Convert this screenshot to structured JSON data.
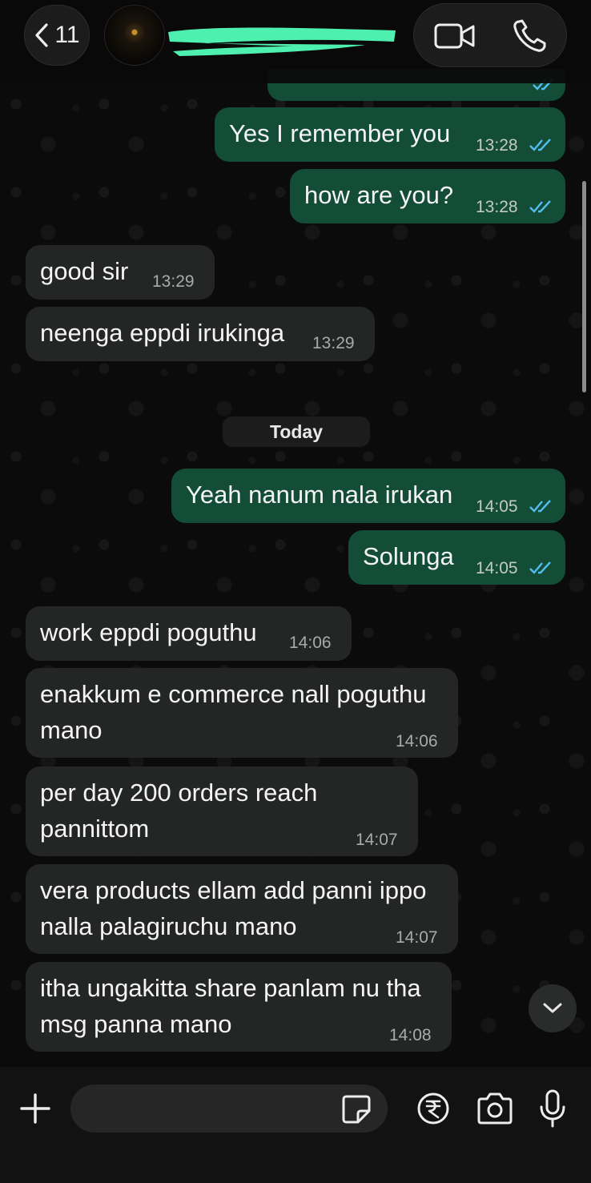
{
  "header": {
    "back_count": "11",
    "contact_name": "",
    "video_call_icon": "video-camera-icon",
    "voice_call_icon": "phone-icon"
  },
  "messages": [
    {
      "direction": "out",
      "text": "Yes I remember you",
      "time": "13:28",
      "status": "read"
    },
    {
      "direction": "out",
      "text": "how are you?",
      "time": "13:28",
      "status": "read"
    },
    {
      "direction": "in",
      "text": "good sir",
      "time": "13:29"
    },
    {
      "direction": "in",
      "text": "neenga eppdi irukinga",
      "time": "13:29"
    },
    {
      "direction": "out",
      "text": "Yeah nanum nala irukan",
      "time": "14:05",
      "status": "read"
    },
    {
      "direction": "out",
      "text": "Solunga",
      "time": "14:05",
      "status": "read"
    },
    {
      "direction": "in",
      "text": "work eppdi poguthu",
      "time": "14:06"
    },
    {
      "direction": "in",
      "text": "enakkum e commerce nall poguthu\nmano",
      "time": "14:06"
    },
    {
      "direction": "in",
      "text": "per day 200 orders reach\npannittom",
      "time": "14:07"
    },
    {
      "direction": "in",
      "text": "vera products ellam add panni ippo\nnalla palagiruchu mano",
      "time": "14:07"
    },
    {
      "direction": "in",
      "text": "itha ungakitta share panlam nu tha\nmsg panna mano",
      "time": "14:08"
    }
  ],
  "date_divider": "Today",
  "composer": {
    "input_value": "",
    "icons": [
      "plus-icon",
      "sticker-icon",
      "rupee-icon",
      "camera-icon",
      "microphone-icon"
    ]
  },
  "colors": {
    "outgoing_bubble": "#134d37",
    "incoming_bubble": "#242626",
    "read_ticks": "#53bdeb",
    "redaction": "#4ef0b0"
  }
}
